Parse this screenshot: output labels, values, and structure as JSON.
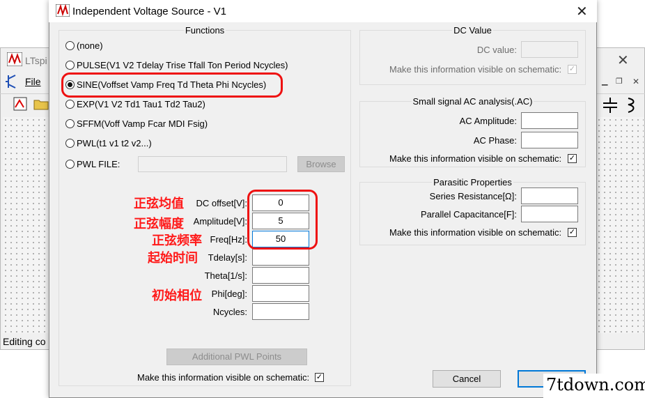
{
  "background_window": {
    "title": "LTspi",
    "menu_file": "File",
    "status": "Editing co"
  },
  "dialog": {
    "title": "Independent Voltage Source - V1",
    "functions": {
      "legend": "Functions",
      "options": [
        {
          "label": "(none)",
          "selected": false
        },
        {
          "label": "PULSE(V1 V2 Tdelay Trise Tfall Ton Period Ncycles)",
          "selected": false
        },
        {
          "label": "SINE(Voffset Vamp Freq Td Theta Phi Ncycles)",
          "selected": true
        },
        {
          "label": "EXP(V1 V2 Td1 Tau1 Td2 Tau2)",
          "selected": false
        },
        {
          "label": "SFFM(Voff Vamp Fcar MDI Fsig)",
          "selected": false
        },
        {
          "label": "PWL(t1 v1 t2 v2...)",
          "selected": false
        },
        {
          "label": "PWL FILE:",
          "selected": false
        }
      ],
      "browse_label": "Browse",
      "params": [
        {
          "label": "DC offset[V]:",
          "value": "0"
        },
        {
          "label": "Amplitude[V]:",
          "value": "5"
        },
        {
          "label": "Freq[Hz]:",
          "value": "50"
        },
        {
          "label": "Tdelay[s]:",
          "value": ""
        },
        {
          "label": "Theta[1/s]:",
          "value": ""
        },
        {
          "label": "Phi[deg]:",
          "value": ""
        },
        {
          "label": "Ncycles:",
          "value": ""
        }
      ],
      "additional_pwl_label": "Additional PWL Points",
      "visible_label": "Make this information visible on schematic:",
      "visible_checked": true
    },
    "dc_value": {
      "legend": "DC Value",
      "label": "DC value:",
      "value": "",
      "visible_label": "Make this information visible on schematic:",
      "visible_checked": true
    },
    "small_signal": {
      "legend": "Small signal AC analysis(.AC)",
      "amplitude_label": "AC Amplitude:",
      "amplitude_value": "",
      "phase_label": "AC Phase:",
      "phase_value": "",
      "visible_label": "Make this information visible on schematic:",
      "visible_checked": true
    },
    "parasitic": {
      "legend": "Parasitic Properties",
      "series_label": "Series Resistance[Ω]:",
      "series_value": "",
      "parallel_label": "Parallel Capacitance[F]:",
      "parallel_value": "",
      "visible_label": "Make this information visible on schematic:",
      "visible_checked": true
    },
    "cancel_label": "Cancel",
    "ok_label": ""
  },
  "annotations": {
    "dc_offset": "正弦均值",
    "amplitude": "正弦幅度",
    "freq": "正弦频率",
    "tdelay": "起始时间",
    "phi": "初始相位"
  },
  "watermark": "7tdown.com",
  "colors": {
    "annotation_red": "#ff1a1a",
    "focus_blue": "#0078d7",
    "dialog_bg": "#f0f0f0"
  }
}
